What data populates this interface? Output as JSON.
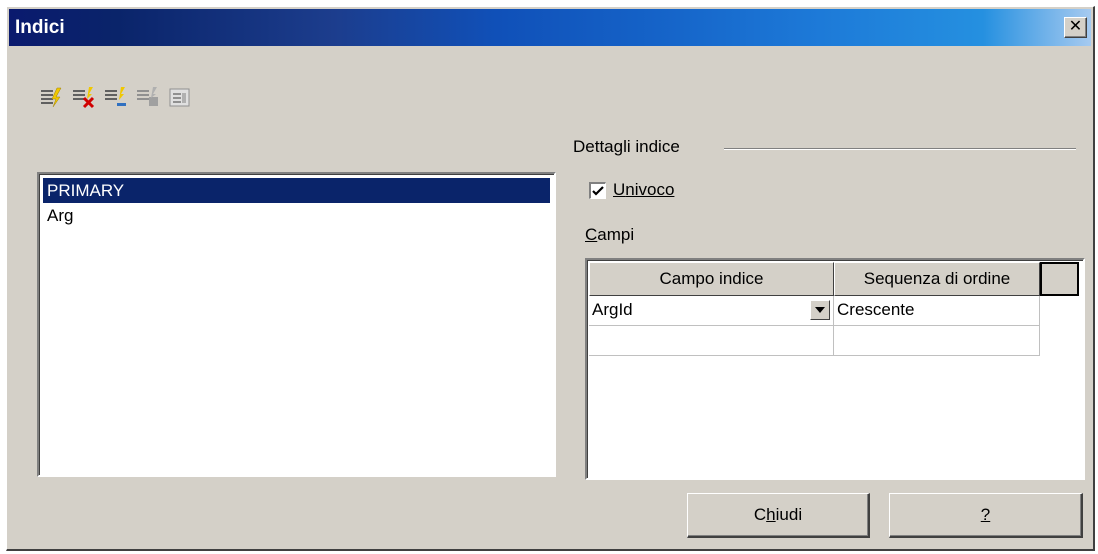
{
  "window": {
    "title": "Indici"
  },
  "toolbar": {
    "icons": [
      "add-index-icon",
      "delete-index-icon",
      "rename-index-icon",
      "edit-index-icon",
      "index-properties-icon"
    ]
  },
  "index_list": {
    "items": [
      "PRIMARY",
      "Arg"
    ],
    "selected": "PRIMARY"
  },
  "details": {
    "group_label": "Dettagli indice",
    "unique_checkbox": {
      "accel": "U",
      "label_rest": "nivoco",
      "checked": true
    },
    "fields_label": {
      "accel": "C",
      "rest": "ampi"
    }
  },
  "fields_grid": {
    "headers": [
      "Campo indice",
      "Sequenza di ordine"
    ],
    "rows": [
      {
        "field": "ArgId",
        "order": "Crescente"
      },
      {
        "field": "",
        "order": ""
      }
    ]
  },
  "buttons": {
    "close": {
      "pre": "C",
      "accel": "h",
      "post": "iudi"
    },
    "help": {
      "accel": "?"
    }
  },
  "colors": {
    "selection": "#0a246a",
    "face": "#d4d0c8"
  }
}
